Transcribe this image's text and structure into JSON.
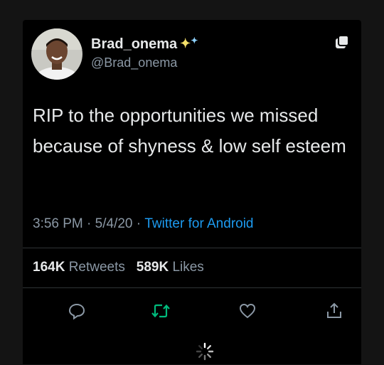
{
  "tweet": {
    "display_name": "Brad_onema",
    "handle": "@Brad_onema",
    "text": "RIP to the opportunities we missed because of shyness & low self esteem",
    "time": "3:56 PM",
    "date": "5/4/20",
    "source": "Twitter for Android",
    "retweets_count": "164K",
    "retweets_label": "Retweets",
    "likes_count": "589K",
    "likes_label": "Likes"
  },
  "colors": {
    "background": "#000000",
    "text": "#e7e9ea",
    "secondary": "#8b98a5",
    "accent": "#1d9bf0",
    "retweet_green": "#00ba7c"
  },
  "icons": {
    "top_right": "copy-icon",
    "actions": [
      "reply-icon",
      "retweet-icon",
      "like-icon",
      "share-icon"
    ]
  }
}
